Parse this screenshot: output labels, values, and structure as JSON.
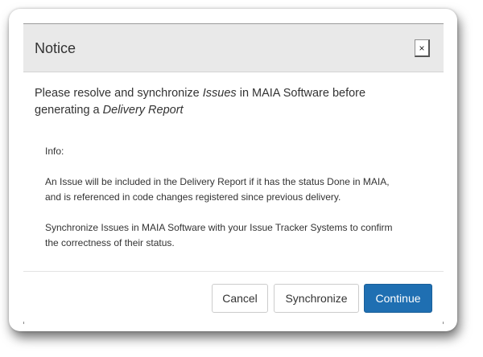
{
  "dialog": {
    "title": "Notice",
    "close_label": "×",
    "message": {
      "part1": "Please resolve and synchronize ",
      "issues_em": "Issues",
      "part2": " in MAIA Software before generating a ",
      "report_em": "Delivery Report"
    },
    "info": {
      "label": "Info:",
      "paragraph1_line1": "An Issue will be included in the Delivery Report if it has the status Done in MAIA,",
      "paragraph1_line2": "and is referenced in code changes registered since previous delivery.",
      "paragraph2_line1": "Synchronize Issues in MAIA Software with your Issue Tracker Systems to confirm",
      "paragraph2_line2": "the correctness of their status."
    },
    "buttons": {
      "cancel": "Cancel",
      "synchronize": "Synchronize",
      "continue": "Continue"
    }
  },
  "colors": {
    "header_bg": "#e9e9e9",
    "primary": "#1f6fb2",
    "text": "#333333"
  }
}
